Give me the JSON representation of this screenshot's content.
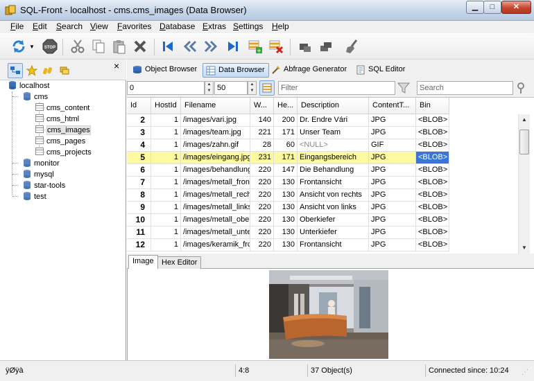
{
  "window": {
    "title": "SQL-Front - localhost - cms.cms_images  (Data Browser)"
  },
  "menu": [
    "File",
    "Edit",
    "Search",
    "View",
    "Favorites",
    "Database",
    "Extras",
    "Settings",
    "Help"
  ],
  "toolbar": {
    "buttons": [
      "refresh-icon",
      "dropdown-arrow-icon",
      "stop-icon",
      "cut-icon",
      "copy-icon",
      "paste-icon",
      "delete-icon",
      "first-record-icon",
      "previous-record-icon",
      "next-record-icon",
      "last-record-icon",
      "insert-record-icon",
      "delete-record-icon",
      "post-icon",
      "cancel-icon",
      "clear-icon"
    ]
  },
  "left": {
    "close_label": "×",
    "tree": [
      {
        "label": "localhost",
        "level": 0,
        "kind": "server"
      },
      {
        "label": "cms",
        "level": 1,
        "kind": "database"
      },
      {
        "label": "cms_content",
        "level": 2,
        "kind": "table"
      },
      {
        "label": "cms_html",
        "level": 2,
        "kind": "table"
      },
      {
        "label": "cms_images",
        "level": 2,
        "kind": "table",
        "selected": true
      },
      {
        "label": "cms_pages",
        "level": 2,
        "kind": "table"
      },
      {
        "label": "cms_projects",
        "level": 2,
        "kind": "table"
      },
      {
        "label": "monitor",
        "level": 1,
        "kind": "database"
      },
      {
        "label": "mysql",
        "level": 1,
        "kind": "database"
      },
      {
        "label": "star-tools",
        "level": 1,
        "kind": "database"
      },
      {
        "label": "test",
        "level": 1,
        "kind": "database"
      }
    ]
  },
  "views": {
    "tabs": [
      "Object Browser",
      "Data Browser",
      "Abfrage Generator",
      "SQL Editor"
    ],
    "active": "Data Browser"
  },
  "navbar": {
    "offset": "0",
    "limit": "50",
    "filter_placeholder": "Filter",
    "search_placeholder": "Search"
  },
  "grid": {
    "columns": [
      "Id",
      "HostId",
      "Filename",
      "W...",
      "He...",
      "Description",
      "ContentT...",
      "Bin"
    ],
    "rows": [
      [
        "2",
        "1",
        "/images/vari.jpg",
        "140",
        "200",
        "Dr. Endre Vári",
        "JPG",
        "<BLOB>"
      ],
      [
        "3",
        "1",
        "/images/team.jpg",
        "221",
        "171",
        "Unser Team",
        "JPG",
        "<BLOB>"
      ],
      [
        "4",
        "1",
        "/images/zahn.gif",
        "28",
        "60",
        "<NULL>",
        "GIF",
        "<BLOB>"
      ],
      [
        "5",
        "1",
        "/images/eingang.jpg",
        "231",
        "171",
        "Eingangsbereich",
        "JPG",
        "<BLOB>"
      ],
      [
        "6",
        "1",
        "/images/behandlung",
        "220",
        "147",
        "Die Behandlung",
        "JPG",
        "<BLOB>"
      ],
      [
        "7",
        "1",
        "/images/metall_front",
        "220",
        "130",
        "Frontansicht",
        "JPG",
        "<BLOB>"
      ],
      [
        "8",
        "1",
        "/images/metall_rech",
        "220",
        "130",
        "Ansicht von rechts",
        "JPG",
        "<BLOB>"
      ],
      [
        "9",
        "1",
        "/images/metall_links",
        "220",
        "130",
        "Ansicht von links",
        "JPG",
        "<BLOB>"
      ],
      [
        "10",
        "1",
        "/images/metall_ober",
        "220",
        "130",
        "Oberkiefer",
        "JPG",
        "<BLOB>"
      ],
      [
        "11",
        "1",
        "/images/metall_unte",
        "220",
        "130",
        "Unterkiefer",
        "JPG",
        "<BLOB>"
      ],
      [
        "12",
        "1",
        "/images/keramik_frc",
        "220",
        "130",
        "Frontansicht",
        "JPG",
        "<BLOB>"
      ]
    ],
    "selected_row": "5"
  },
  "bottom_tabs": [
    "Image",
    "Hex Editor"
  ],
  "status": {
    "text": "ÿØÿà",
    "position": "4:8",
    "objects": "37 Object(s)",
    "connected": "Connected since: 10:24"
  }
}
